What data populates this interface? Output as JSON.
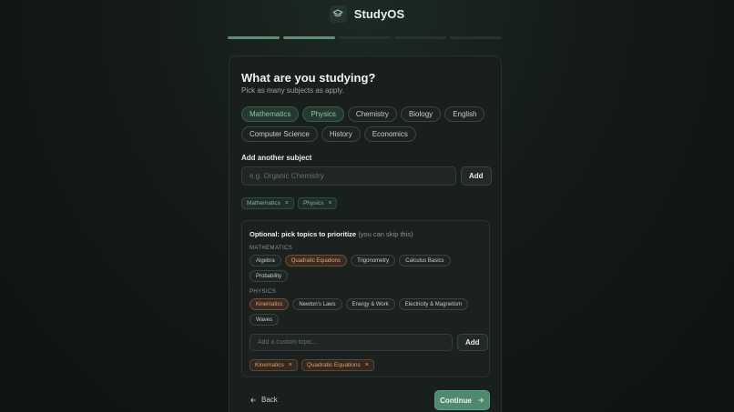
{
  "app": {
    "title": "StudyOS",
    "logo_icon": "graduation-cap-icon"
  },
  "progress": {
    "total_steps": 5,
    "completed_steps": 2,
    "accent": "#5e8f78"
  },
  "card": {
    "title": "What are you studying?",
    "subtitle": "Pick as many subjects as apply.",
    "subjects": [
      {
        "label": "Mathematics",
        "selected": true
      },
      {
        "label": "Physics",
        "selected": true
      },
      {
        "label": "Chemistry",
        "selected": false
      },
      {
        "label": "Biology",
        "selected": false
      },
      {
        "label": "English",
        "selected": false
      },
      {
        "label": "Computer Science",
        "selected": false
      },
      {
        "label": "History",
        "selected": false
      },
      {
        "label": "Economics",
        "selected": false
      }
    ],
    "add_subject": {
      "label": "Add another subject",
      "placeholder": "e.g. Organic Chemistry",
      "value": "",
      "button": "Add"
    },
    "selected_subjects": [
      "Mathematics",
      "Physics"
    ]
  },
  "optional": {
    "title": "Optional: pick topics to prioritize",
    "hint": "(you can skip this)",
    "groups": [
      {
        "label": "MATHEMATICS",
        "topics": [
          {
            "label": "Algebra",
            "selected": false
          },
          {
            "label": "Quadratic Equations",
            "selected": true
          },
          {
            "label": "Trigonometry",
            "selected": false
          },
          {
            "label": "Calculus Basics",
            "selected": false
          },
          {
            "label": "Probability",
            "selected": false
          }
        ]
      },
      {
        "label": "PHYSICS",
        "topics": [
          {
            "label": "Kinematics",
            "selected": true
          },
          {
            "label": "Newton's Laws",
            "selected": false
          },
          {
            "label": "Energy & Work",
            "selected": false
          },
          {
            "label": "Electricity & Magnetism",
            "selected": false
          },
          {
            "label": "Waves",
            "selected": false
          }
        ]
      }
    ],
    "custom_topic": {
      "placeholder": "Add a custom topic...",
      "value": "",
      "button": "Add"
    },
    "selected_topics": [
      "Kinematics",
      "Quadratic Equations"
    ]
  },
  "footer": {
    "back_label": "Back",
    "continue_label": "Continue"
  },
  "colors": {
    "accent_green": "#4f8a6e",
    "topic_orange": "#e1a776",
    "background": "#141a17"
  }
}
